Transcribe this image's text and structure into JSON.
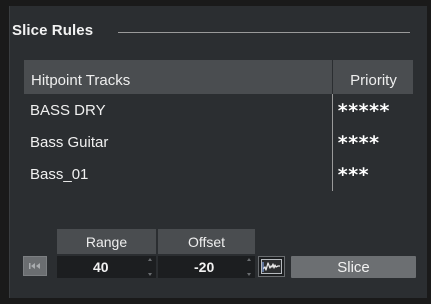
{
  "section": {
    "title": "Slice Rules"
  },
  "table": {
    "headers": {
      "tracks": "Hitpoint Tracks",
      "priority": "Priority"
    },
    "rows": [
      {
        "name": "BASS DRY",
        "priority": "*****"
      },
      {
        "name": "Bass Guitar",
        "priority": "****"
      },
      {
        "name": "Bass_01",
        "priority": "***"
      }
    ]
  },
  "controls": {
    "range_label": "Range",
    "range_value": "40",
    "offset_label": "Offset",
    "offset_value": "-20",
    "slice_label": "Slice"
  },
  "icons": {
    "skip": "skip-to-start-icon",
    "preview": "waveform-preview-icon"
  },
  "colors": {
    "panel": "#2b2e31",
    "header": "#4a4d50",
    "button": "#6c6f72"
  }
}
